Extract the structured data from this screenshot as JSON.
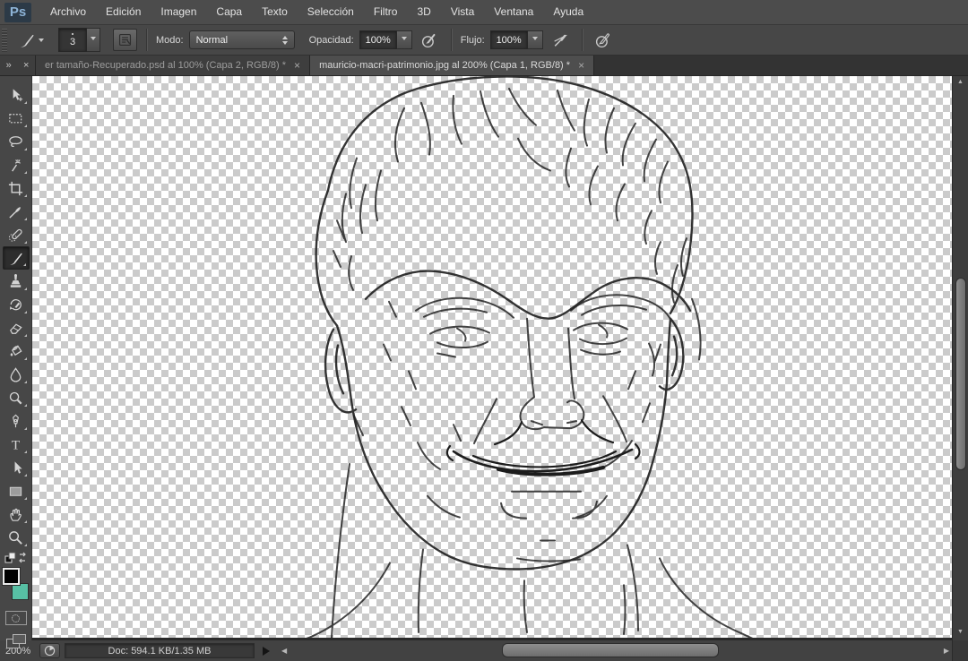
{
  "app": {
    "logo_text": "Ps"
  },
  "menu_bar": {
    "items": [
      "Archivo",
      "Edición",
      "Imagen",
      "Capa",
      "Texto",
      "Selección",
      "Filtro",
      "3D",
      "Vista",
      "Ventana",
      "Ayuda"
    ]
  },
  "options_bar": {
    "brush_size": "3",
    "mode_label": "Modo:",
    "mode_value": "Normal",
    "opacity_label": "Opacidad:",
    "opacity_value": "100%",
    "flow_label": "Flujo:",
    "flow_value": "100%"
  },
  "tab_bar": {
    "dock_collapse_glyph": "»",
    "dock_close_glyph": "×",
    "tabs": [
      {
        "label": "er tamaño-Recuperado.psd al 100% (Capa 2, RGB/8) *",
        "close_glyph": "×",
        "active": false
      },
      {
        "label": "mauricio-macri-patrimonio.jpg al 200% (Capa 1, RGB/8) *",
        "close_glyph": "×",
        "active": true
      }
    ]
  },
  "toolbar": {
    "tools": [
      {
        "name": "move-tool",
        "selected": false
      },
      {
        "name": "marquee-tool",
        "selected": false
      },
      {
        "name": "lasso-tool",
        "selected": false
      },
      {
        "name": "magic-wand-tool",
        "selected": false
      },
      {
        "name": "crop-tool",
        "selected": false
      },
      {
        "name": "eyedropper-tool",
        "selected": false
      },
      {
        "name": "healing-brush-tool",
        "selected": false
      },
      {
        "name": "brush-tool",
        "selected": true
      },
      {
        "name": "clone-stamp-tool",
        "selected": false
      },
      {
        "name": "history-brush-tool",
        "selected": false
      },
      {
        "name": "eraser-tool",
        "selected": false
      },
      {
        "name": "paint-bucket-tool",
        "selected": false
      },
      {
        "name": "blur-tool",
        "selected": false
      },
      {
        "name": "dodge-tool",
        "selected": false
      },
      {
        "name": "pen-tool",
        "selected": false
      },
      {
        "name": "type-tool",
        "selected": false
      },
      {
        "name": "path-selection-tool",
        "selected": false
      },
      {
        "name": "rectangle-tool",
        "selected": false
      },
      {
        "name": "hand-tool",
        "selected": false
      },
      {
        "name": "zoom-tool",
        "selected": false
      }
    ],
    "foreground_color": "#000000",
    "background_color": "#57c0a4"
  },
  "canvas": {
    "artwork_description": "Black line-art sketch of a man's face (hair, eyes, nose, wide smile, neck and shoulders) drawn on a transparent checkerboard canvas"
  },
  "status_bar": {
    "zoom_level": "200%",
    "doc_info": "Doc: 594.1 KB/1.35 MB"
  },
  "colors": {
    "checker_light": "#ffffff",
    "checker_dark": "#cbcbcb",
    "ui_gray": "#474747",
    "logo_blue": "#8db3d6",
    "background_swatch_teal": "#57c0a4"
  }
}
